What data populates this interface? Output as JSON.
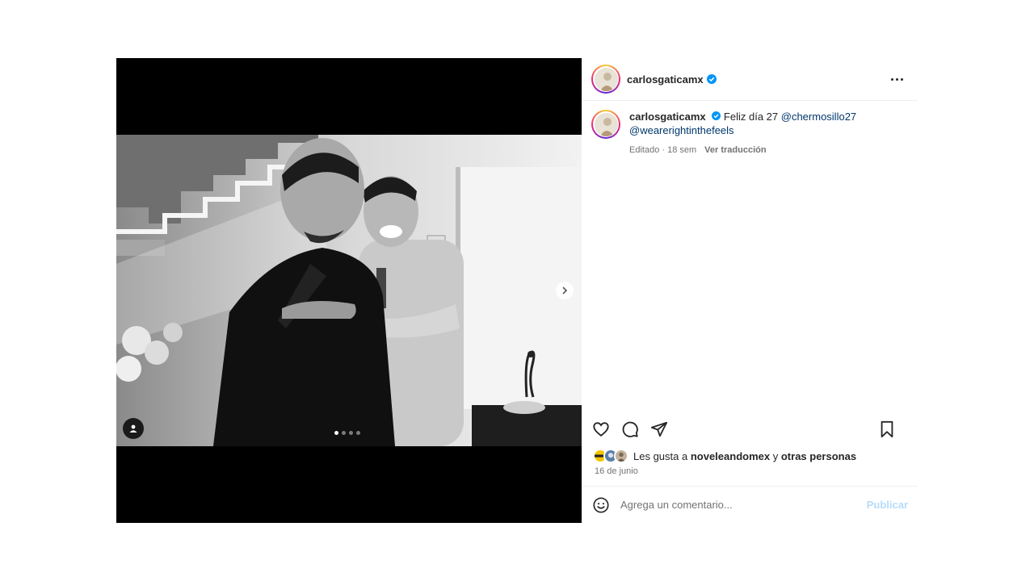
{
  "post": {
    "username": "carlosgaticamx",
    "caption": {
      "username": "carlosgaticamx",
      "text": "Feliz día 27",
      "mention_1": "@chermosillo27",
      "mention_2": "@wearerightinthefeels",
      "edited": "Editado · 18 sem",
      "translate": "Ver traducción"
    },
    "carousel": {
      "slide_count": 4,
      "active_index": 0
    },
    "likes": {
      "prefix": "Les gusta a",
      "user": "noveleandomex",
      "conjunction": "y",
      "others": "otras personas"
    },
    "date": "16 de junio",
    "comment": {
      "placeholder": "Agrega un comentario...",
      "publish_label": "Publicar"
    }
  },
  "icons": {
    "verified": "verified-badge-icon",
    "more": "more-options-icon",
    "like": "heart-icon",
    "comment": "comment-icon",
    "share": "paper-plane-icon",
    "save": "bookmark-icon",
    "emoji": "emoji-icon",
    "next": "chevron-right-icon",
    "tags": "person-tag-icon"
  },
  "colors": {
    "verified": "#0095f6",
    "mention": "#00376b",
    "publish_disabled": "#b6dbfb"
  }
}
